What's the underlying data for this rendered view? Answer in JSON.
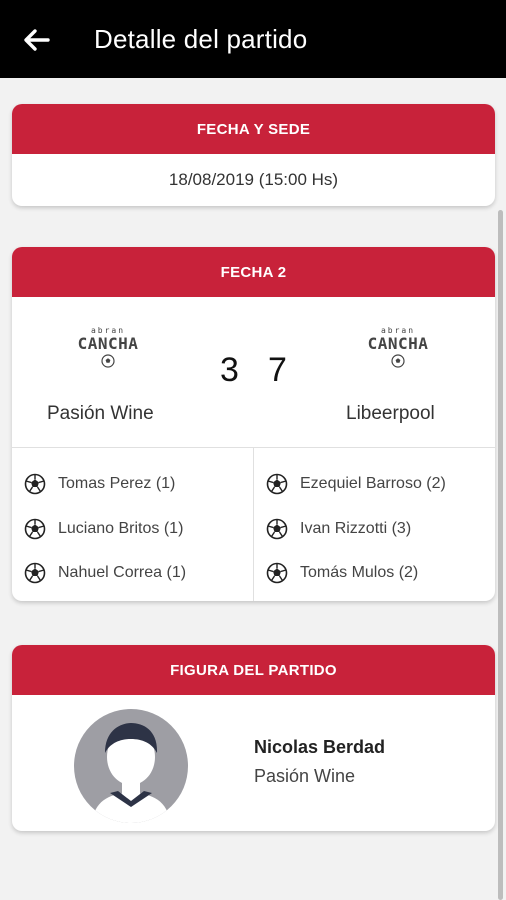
{
  "appbar": {
    "title": "Detalle del partido",
    "back_icon": "arrow-left-icon"
  },
  "fecha_sede": {
    "header": "FECHA Y SEDE",
    "datetime": "18/08/2019 (15:00 Hs)"
  },
  "match": {
    "header": "FECHA 2",
    "home": {
      "name": "Pasión Wine",
      "logo_small": "abran",
      "logo_big": "CANCHA",
      "score": "3"
    },
    "away": {
      "name": "Libeerpool",
      "logo_small": "abran",
      "logo_big": "CANCHA",
      "score": "7"
    },
    "home_scorers": [
      "Tomas Perez (1)",
      "Luciano Britos (1)",
      "Nahuel Correa (1)"
    ],
    "away_scorers": [
      "Ezequiel Barroso (2)",
      "Ivan Rizzotti (3)",
      "Tomás Mulos (2)"
    ]
  },
  "figura": {
    "header": "FIGURA DEL PARTIDO",
    "player_name": "Nicolas Berdad",
    "player_team": "Pasión Wine"
  },
  "colors": {
    "accent": "#c8223a",
    "appbar": "#000000",
    "background": "#f2f2f2"
  }
}
